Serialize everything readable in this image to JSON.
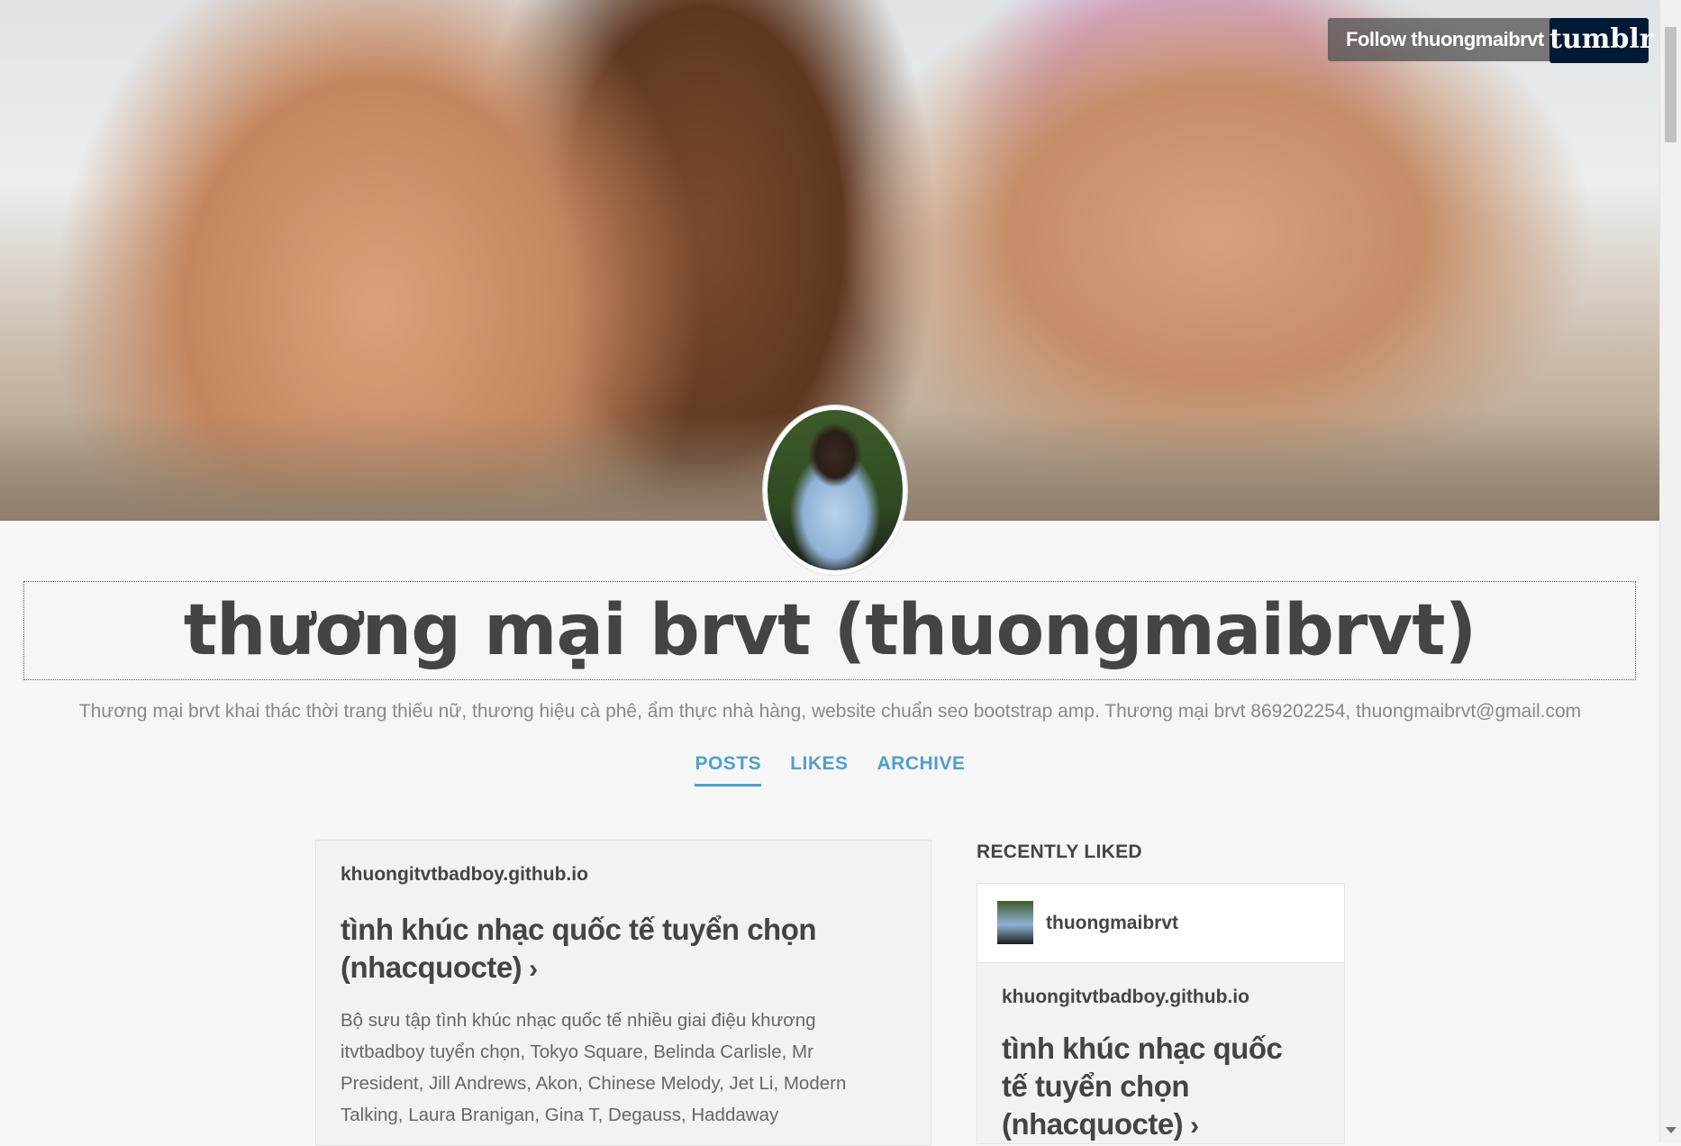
{
  "header": {
    "follow_label": "Follow thuongmaibrvt",
    "logo_text": "tumblr"
  },
  "blog": {
    "title": "thương mại brvt (thuongmaibrvt)",
    "description": "Thương mại brvt khai thác thời trang thiếu nữ, thương hiệu cà phê, ẩm thực nhà hàng, website chuẩn seo bootstrap amp. Thương mại brvt 869202254, thuongmaibrvt@gmail.com"
  },
  "nav": {
    "items": [
      {
        "label": "POSTS",
        "active": true
      },
      {
        "label": "LIKES",
        "active": false
      },
      {
        "label": "ARCHIVE",
        "active": false
      }
    ]
  },
  "post": {
    "source": "khuongitvtbadboy.github.io",
    "title": "tình khúc nhạc quốc tế tuyển chọn (nhacquocte)",
    "chevron": "›",
    "body": "Bộ sưu tập tình khúc nhạc quốc tế nhiều giai điệu khương itvtbadboy tuyển chọn, Tokyo Square, Belinda Carlisle, Mr President, Jill Andrews, Akon, Chinese Melody, Jet Li, Modern Talking, Laura Branigan, Gina T, Degauss, Haddaway"
  },
  "sidebar": {
    "heading": "RECENTLY LIKED",
    "liked": {
      "username": "thuongmaibrvt",
      "source": "khuongitvtbadboy.github.io",
      "title": "tình khúc nhạc quốc tế tuyển chọn (nhacquocte)",
      "chevron": "›"
    }
  },
  "colors": {
    "accent": "#529ecc",
    "tumblr_brand": "#001935",
    "text": "#444444"
  }
}
